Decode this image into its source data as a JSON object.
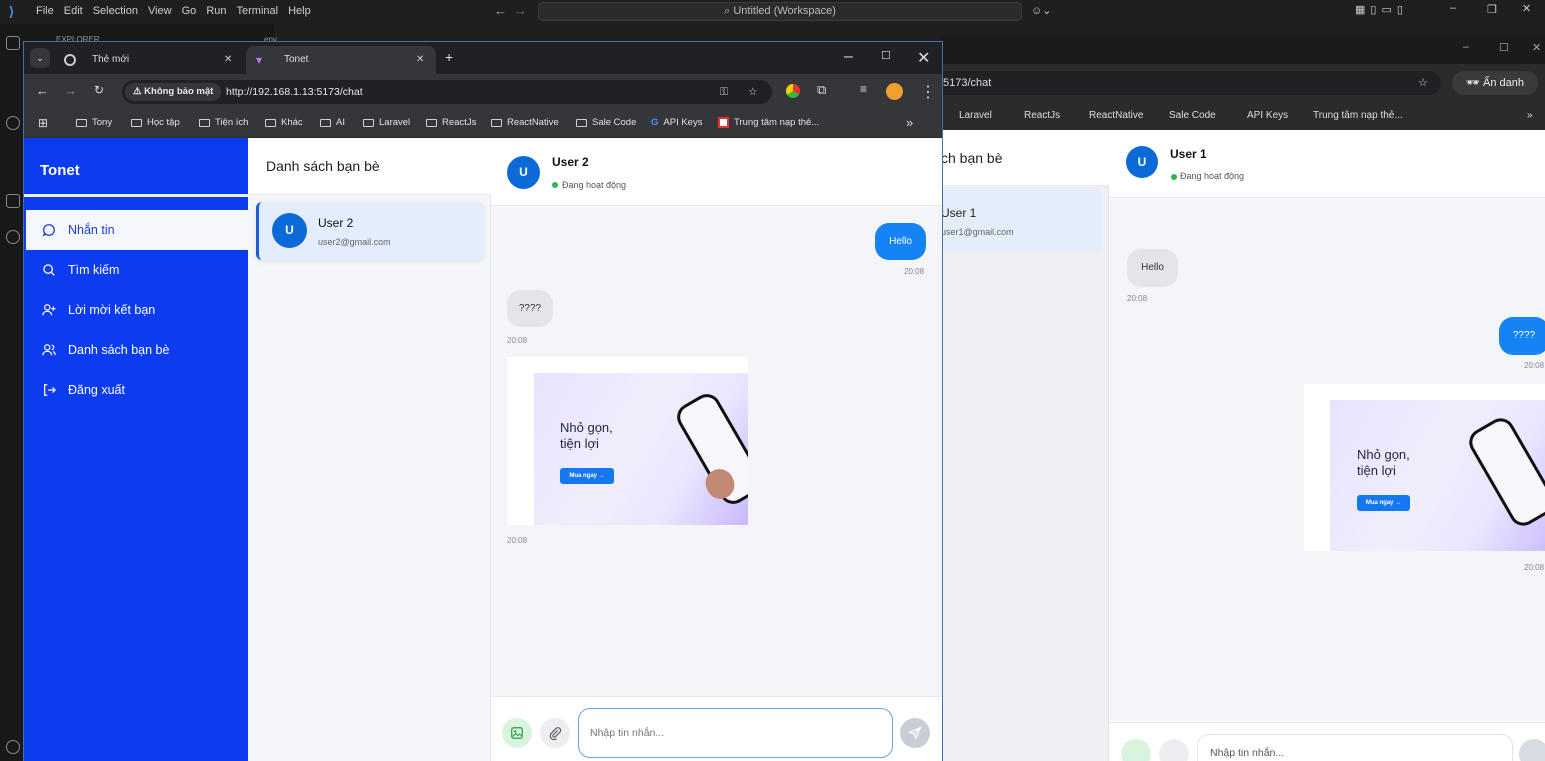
{
  "vscode": {
    "menu": [
      "File",
      "Edit",
      "Selection",
      "View",
      "Go",
      "Run",
      "Terminal",
      "Help"
    ],
    "search": "Untitled (Workspace)",
    "explorer_label": "EXPLORER",
    "editor_tab": "env"
  },
  "browser": {
    "tabs": [
      {
        "label": "Thẻ mới"
      },
      {
        "label": "Tonet"
      }
    ],
    "new_tab": "+",
    "security_label": "Không bảo mật",
    "url": "http://192.168.1.13:5173/chat",
    "bookmarks": [
      "Tony",
      "Học tập",
      "Tiện ích",
      "Khác",
      "AI",
      "Laravel",
      "ReactJs",
      "ReactNative",
      "Sale Code",
      "API Keys",
      "Trung tâm nạp thẻ..."
    ],
    "more": "»"
  },
  "app": {
    "brand": "Tonet",
    "nav": [
      {
        "label": "Nhắn tin",
        "icon": "message-icon"
      },
      {
        "label": "Tìm kiếm",
        "icon": "search-icon"
      },
      {
        "label": "Lời mời kết bạn",
        "icon": "user-plus-icon"
      },
      {
        "label": "Danh sách bạn bè",
        "icon": "users-icon"
      },
      {
        "label": "Đăng xuất",
        "icon": "logout-icon"
      }
    ],
    "friends_title": "Danh sách bạn bè",
    "friends": [
      {
        "avatar": "U",
        "name": "User 2",
        "email": "user2@gmail.com"
      }
    ],
    "chat": {
      "avatar": "U",
      "name": "User 2",
      "status": "Đang hoạt động",
      "messages": [
        {
          "from": "me",
          "text": "Hello",
          "time": "20:08"
        },
        {
          "from": "them",
          "text": "????",
          "time": "20:08"
        },
        {
          "from": "them",
          "type": "image",
          "time": "20:08"
        }
      ],
      "ad": {
        "title_line1": "Nhỏ gọn,",
        "title_line2": "tiện lợi",
        "button": "Mua ngay →"
      },
      "input_placeholder": "Nhập tin nhắn..."
    }
  },
  "background_browser": {
    "url": "5173/chat",
    "incognito": "Ẩn danh",
    "bookmarks": [
      "Laravel",
      "ReactJs",
      "ReactNative",
      "Sale Code",
      "API Keys",
      "Trung tâm nạp thẻ..."
    ],
    "friends_title": "ch bạn bè",
    "friend_name": "User 1",
    "friend_email": "user1@gmail.com",
    "chat_name": "User 1",
    "chat_avatar": "U",
    "status": "Đang hoạt động",
    "msg1": "Hello",
    "msg2": "????",
    "time": "20:08",
    "input_placeholder": "Nhập tin nhắn...",
    "more": "»"
  },
  "colors": {
    "sidebar": "#0d3cf0",
    "accent": "#0c6ad8",
    "bubble_me": "#1683f5",
    "online": "#2db84d"
  }
}
